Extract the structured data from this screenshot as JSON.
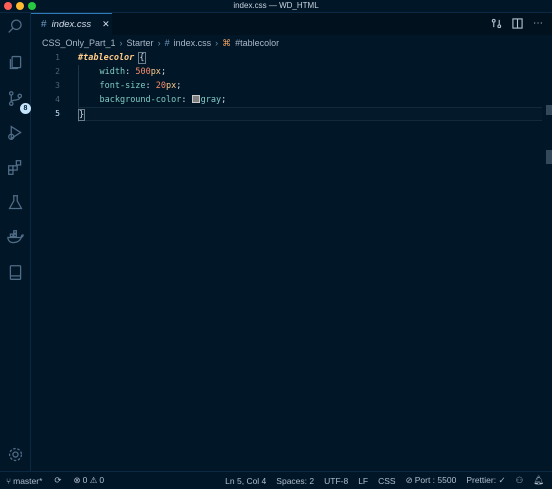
{
  "window": {
    "title": "index.css — WD_HTML"
  },
  "colors": {
    "close": "#fe5f57",
    "minimize": "#febc2e",
    "maximize": "#28c840"
  },
  "activity_bar": {
    "icons": [
      "search-icon",
      "files-icon",
      "source-control-icon",
      "run-debug-icon",
      "extensions-icon",
      "testing-icon",
      "docker-icon",
      "remote-icon",
      "settings-gear-icon"
    ],
    "source_control_badge": "8"
  },
  "tab": {
    "hash": "#",
    "label": "index.css",
    "close": "✕"
  },
  "breadcrumb": {
    "items": [
      "CSS_Only_Part_1",
      "Starter",
      "index.css",
      "#tablecolor"
    ],
    "hash": "#"
  },
  "editor": {
    "line_numbers": [
      "1",
      "2",
      "3",
      "4",
      "5"
    ],
    "selector": "#tablecolor",
    "open_brace": "{",
    "close_brace": "}",
    "lines": [
      {
        "prop": "width",
        "num": "500",
        "unit": "px"
      },
      {
        "prop": "font-size",
        "num": "20",
        "unit": "px"
      },
      {
        "prop": "background-color",
        "value": "gray"
      }
    ]
  },
  "status": {
    "branch": "master*",
    "errors": "0",
    "warnings": "0",
    "position": "Ln 5, Col 4",
    "spaces": "Spaces: 2",
    "encoding": "UTF-8",
    "eol": "LF",
    "language": "CSS",
    "port": "Port : 5500",
    "prettier": "Prettier: ✓"
  }
}
